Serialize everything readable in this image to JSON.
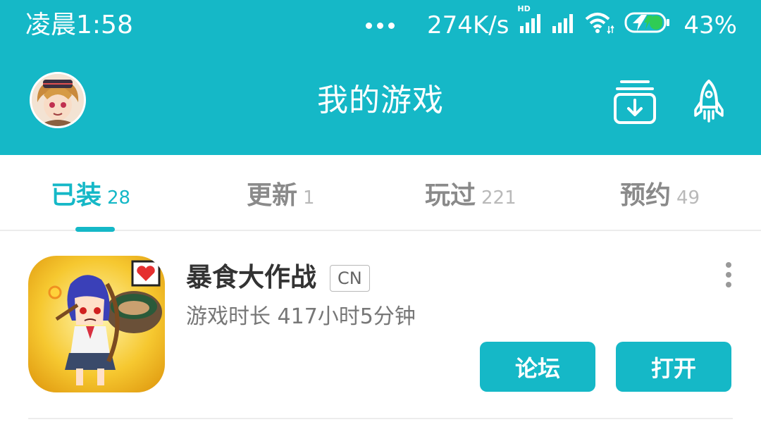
{
  "status_bar": {
    "time": "凌晨1:58",
    "net_speed": "274K/s",
    "hd_tag": "HD",
    "battery_percent": "43%",
    "icons": [
      "more-dots-icon",
      "signal-icon",
      "signal-icon",
      "wifi-icon",
      "battery-charging-icon"
    ]
  },
  "header": {
    "title": "我的游戏",
    "avatar_icon": "avatar",
    "download_icon": "download-manager-icon",
    "rocket_icon": "rocket-icon"
  },
  "tabs": [
    {
      "label": "已装",
      "count": "28",
      "active": true
    },
    {
      "label": "更新",
      "count": "1",
      "active": false
    },
    {
      "label": "玩过",
      "count": "221",
      "active": false
    },
    {
      "label": "预约",
      "count": "49",
      "active": false
    }
  ],
  "games": [
    {
      "name": "暴食大作战",
      "region": "CN",
      "play_time": "游戏时长 417小时5分钟",
      "forum_label": "论坛",
      "open_label": "打开"
    }
  ],
  "colors": {
    "accent": "#15b8c7",
    "text_primary": "#333333",
    "text_secondary": "#777777"
  }
}
